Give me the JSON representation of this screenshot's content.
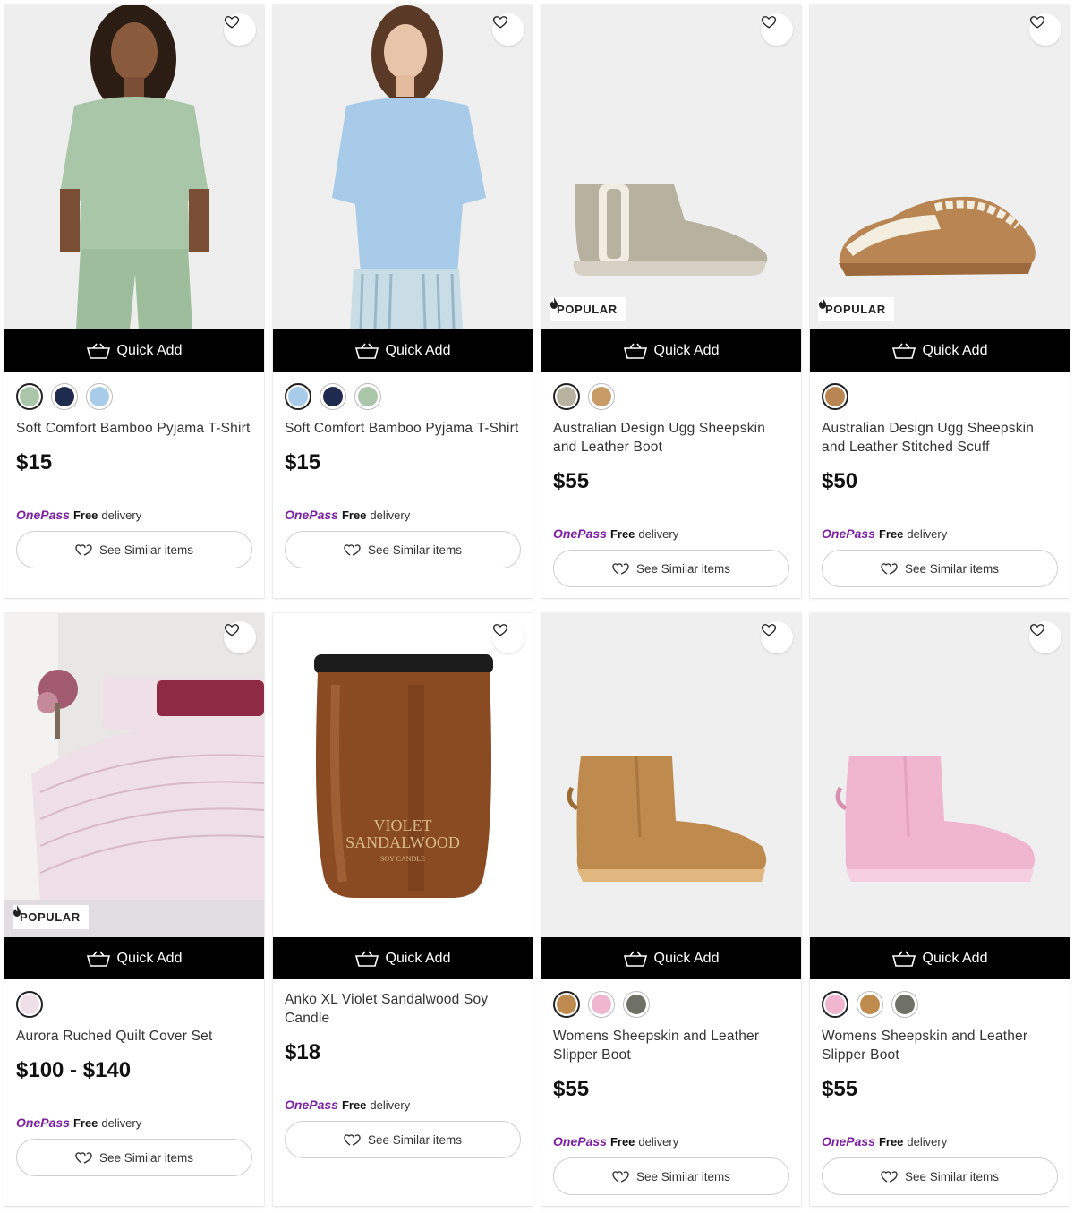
{
  "quick_add_label": "Quick Add",
  "see_similar_label": "See Similar items",
  "popular_label": "POPULAR",
  "onepass_brand": "OnePass",
  "onepass_free": "Free",
  "onepass_delivery": "delivery",
  "colors": {
    "onepass_purple": "#7c1fa3",
    "quick_add_bg": "#000000"
  },
  "products": [
    {
      "title": "Soft Comfort Bamboo Pyjama T-Shirt",
      "price": "$15",
      "popular": false,
      "swatches": [
        "#a9c7a8",
        "#1f2a4f",
        "#a8cbea"
      ]
    },
    {
      "title": "Soft Comfort Bamboo Pyjama T-Shirt",
      "price": "$15",
      "popular": false,
      "swatches": [
        "#a8cbea",
        "#1f2a4f",
        "#a9c7a8"
      ]
    },
    {
      "title": "Australian Design Ugg Sheepskin and Leather Boot",
      "price": "$55",
      "popular": true,
      "swatches": [
        "#b7b19f",
        "#c79a66"
      ]
    },
    {
      "title": "Australian Design Ugg Sheepskin and Leather Stitched Scuff",
      "price": "$50",
      "popular": true,
      "swatches": [
        "#b98552"
      ]
    },
    {
      "title": "Aurora Ruched Quilt Cover Set",
      "price": "$100 - $140",
      "popular": true,
      "swatches": [
        "#efdfe6"
      ]
    },
    {
      "title": "Anko XL Violet Sandalwood Soy Candle",
      "price": "$18",
      "popular": false,
      "swatches": []
    },
    {
      "title": "Womens Sheepskin and Leather Slipper Boot",
      "price": "$55",
      "popular": false,
      "swatches": [
        "#bf8a4e",
        "#f0b6cf",
        "#6f7066"
      ]
    },
    {
      "title": "Womens Sheepskin and Leather Slipper Boot",
      "price": "$55",
      "popular": false,
      "swatches": [
        "#f0b6cf",
        "#bf8a4e",
        "#6f7066"
      ]
    }
  ],
  "candle_label": {
    "line1": "VIOLET",
    "line2": "SANDALWOOD",
    "line3": "SOY CANDLE"
  },
  "boot_brand": "UGG"
}
